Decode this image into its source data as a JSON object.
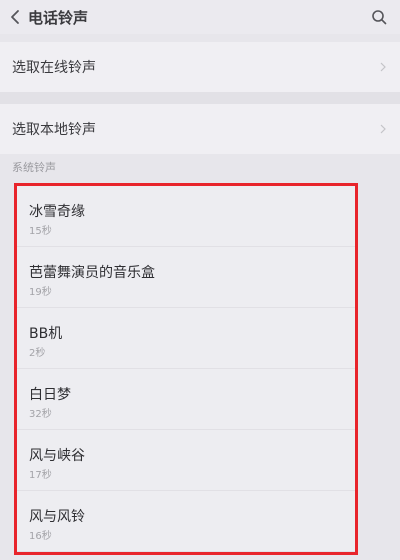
{
  "header": {
    "title": "电话铃声"
  },
  "options": [
    {
      "label": "选取在线铃声"
    },
    {
      "label": "选取本地铃声"
    }
  ],
  "section": {
    "label": "系统铃声"
  },
  "ringtones": [
    {
      "name": "冰雪奇缘",
      "duration": "15秒"
    },
    {
      "name": "芭蕾舞演员的音乐盒",
      "duration": "19秒"
    },
    {
      "name": "BB机",
      "duration": "2秒"
    },
    {
      "name": "白日梦",
      "duration": "32秒"
    },
    {
      "name": "风与峡谷",
      "duration": "17秒"
    },
    {
      "name": "风与风铃",
      "duration": "16秒"
    }
  ],
  "colors": {
    "highlight_border": "#e8242b",
    "background": "#e7e6eb"
  },
  "icons": {
    "back": "chevron-left-icon",
    "search": "search-icon",
    "option_arrow": "chevron-right-icon"
  }
}
